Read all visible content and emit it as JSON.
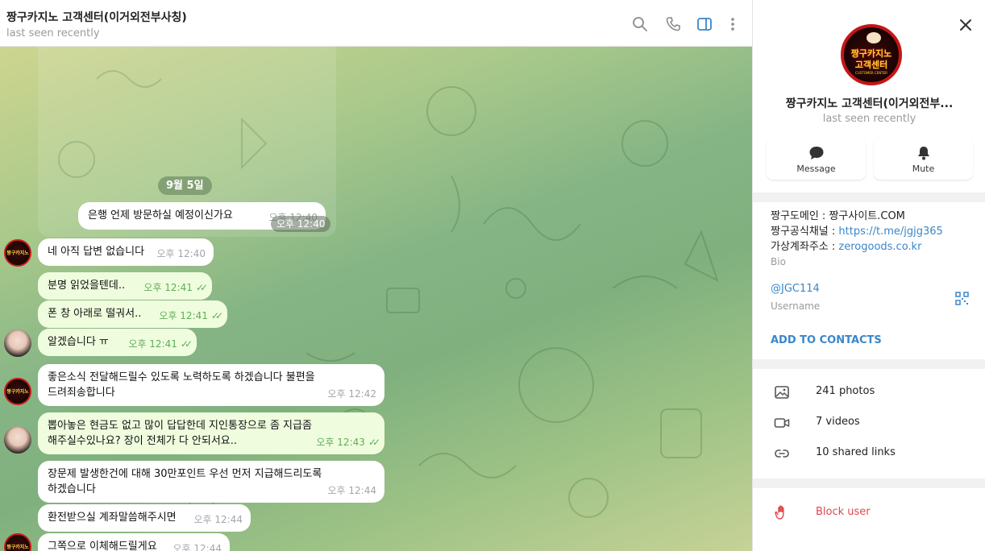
{
  "header": {
    "title": "짱구카지노 고객센터(이거외전부사칭)",
    "status": "last seen recently",
    "icons": [
      "search-icon",
      "phone-icon",
      "sidebar-toggle-icon",
      "more-icon"
    ]
  },
  "date_divider": "9월 5일",
  "messages": [
    {
      "id": "m1",
      "dir": "in",
      "avatar": "none",
      "lines": [
        "은행 언제 방문하실 예정이신가요"
      ],
      "time": "오후 12:40"
    },
    {
      "id": "m2",
      "dir": "in",
      "avatar": "brand",
      "lines": [
        "네 아직 답변 없습니다"
      ],
      "time": "오후 12:40"
    },
    {
      "id": "m3",
      "dir": "out",
      "avatar": "none",
      "lines": [
        "분명 읽었을텐데.."
      ],
      "time": "오후 12:41"
    },
    {
      "id": "m4",
      "dir": "out",
      "avatar": "none",
      "lines": [
        "폰 창 아래로 떨궈서.."
      ],
      "time": "오후 12:41"
    },
    {
      "id": "m5",
      "dir": "out",
      "avatar": "girl",
      "lines": [
        "알겠습니다 ㅠ"
      ],
      "time": "오후 12:41"
    },
    {
      "id": "m6",
      "dir": "in",
      "avatar": "brand",
      "lines": [
        "좋은소식 전달해드릴수 있도록 노력하도록 하겠습니다 불편을",
        "드려죄송합니다"
      ],
      "time": "오후 12:42"
    },
    {
      "id": "m7",
      "dir": "out",
      "avatar": "girl",
      "lines": [
        "뽑아놓은 현금도 없고 많이 답답한데 지인통장으로 좀 지급좀",
        "해주실수있나요? 장이 전체가 다 안되서요.."
      ],
      "time": "오후 12:43"
    },
    {
      "id": "m8",
      "dir": "in",
      "avatar": "none",
      "lines": [
        "장문제 발생한건에 대해 30만포인트 우선 먼저 지급해드리도록",
        "하겠습니다"
      ],
      "time": "오후 12:44"
    },
    {
      "id": "m9",
      "dir": "in",
      "avatar": "none",
      "lines": [
        "환전받으실 계좌말씀해주시면"
      ],
      "time": "오후 12:44"
    },
    {
      "id": "m10",
      "dir": "in",
      "avatar": "brand",
      "lines": [
        "그쪽으로 이체해드릴게요"
      ],
      "time": "오후 12:44"
    }
  ],
  "overlay_time": "오후 12:40",
  "avatar_brand_text": "짱구카지노",
  "panel": {
    "logo_line1": "짱구카지노",
    "logo_line2": "고객센터",
    "logo_line3": "CUSTOMER CENTER",
    "name": "짱구카지노 고객센터(이거외전부...",
    "status": "last seen recently",
    "message_label": "Message",
    "mute_label": "Mute",
    "bio_line1": "짱구도메인 : 짱구사이트.COM",
    "bio_line2_prefix": "짱구공식채널 : ",
    "bio_line2_link": "https://t.me/jgjg365",
    "bio_line3_prefix": "가상계좌주소 : ",
    "bio_line3_link": "zerogoods.co.kr",
    "bio_label": "Bio",
    "username": "@JGC114",
    "username_label": "Username",
    "add_contacts": "ADD TO CONTACTS",
    "photos": "241 photos",
    "videos": "7 videos",
    "links": "10 shared links",
    "block": "Block user"
  },
  "colors": {
    "accent": "#3a87c9",
    "outgoing_bubble": "#effdde",
    "check_green": "#5fae58",
    "danger": "#e0474c",
    "brand_red": "#c51616",
    "brand_gold": "#ffcf2d"
  }
}
